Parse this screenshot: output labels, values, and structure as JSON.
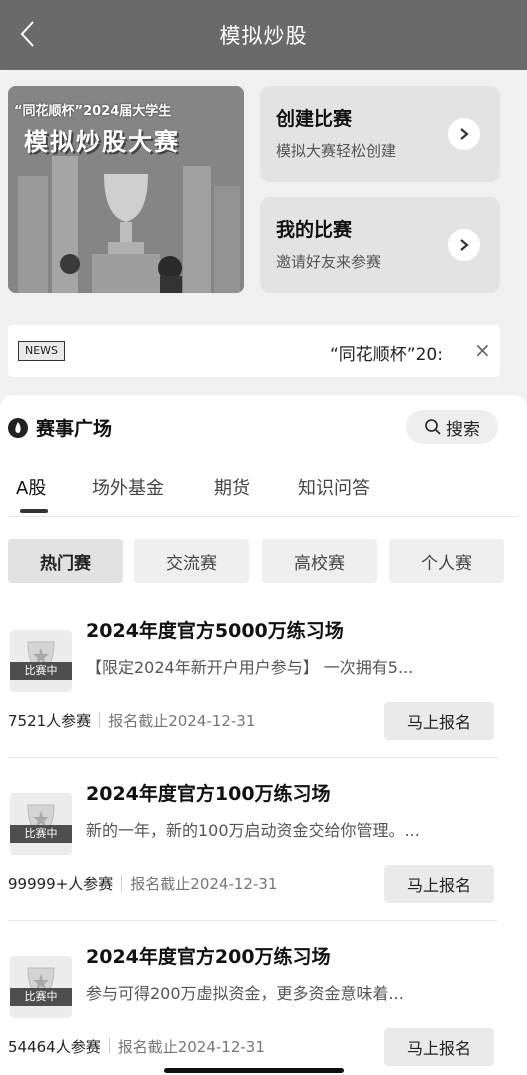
{
  "nav": {
    "title": "模拟炒股",
    "back_icon": "chevron-left-icon"
  },
  "banner": {
    "line1": "“同花顺杯”2024届大学生",
    "line2": "模拟炒股大赛"
  },
  "cards": [
    {
      "title": "创建比赛",
      "subtitle": "模拟大赛轻松创建",
      "icon": "chevron-right-icon"
    },
    {
      "title": "我的比赛",
      "subtitle": "邀请好友来参赛",
      "icon": "chevron-right-icon"
    }
  ],
  "news": {
    "tag": "NEWS",
    "text": "“同花顺杯”20:",
    "close": "×"
  },
  "section": {
    "title": "赛事广场",
    "search_label": "搜索",
    "icon": "flame-icon"
  },
  "tabs": [
    {
      "label": "A股",
      "active": true
    },
    {
      "label": "场外基金",
      "active": false
    },
    {
      "label": "期货",
      "active": false
    },
    {
      "label": "知识问答",
      "active": false
    }
  ],
  "chips": [
    {
      "label": "热门赛",
      "active": true
    },
    {
      "label": "交流赛",
      "active": false
    },
    {
      "label": "高校赛",
      "active": false
    },
    {
      "label": "个人赛",
      "active": false
    }
  ],
  "contests": [
    {
      "title": "2024年度官方5000万练习场",
      "badge": "比赛中",
      "desc": "【限定2024年新开户用户参与】 一次拥有5...",
      "participants": "7521人参赛",
      "deadline": "报名截止2024-12-31",
      "button": "马上报名"
    },
    {
      "title": "2024年度官方100万练习场",
      "badge": "比赛中",
      "desc": "新的一年，新的100万启动资金交给你管理。...",
      "participants": "99999+人参赛",
      "deadline": "报名截止2024-12-31",
      "button": "马上报名"
    },
    {
      "title": "2024年度官方200万练习场",
      "badge": "比赛中",
      "desc": "参与可得200万虚拟资金，更多资金意味着...",
      "participants": "54464人参赛",
      "deadline": "报名截止2024-12-31",
      "button": "马上报名"
    }
  ]
}
